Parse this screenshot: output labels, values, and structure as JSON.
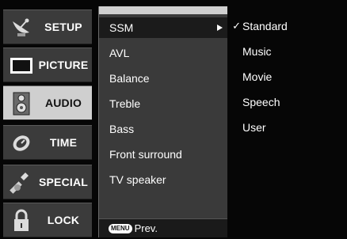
{
  "menu": {
    "categories": [
      {
        "label": "SETUP",
        "icon": "satellite-dish-icon",
        "active": false
      },
      {
        "label": "PICTURE",
        "icon": "tv-screen-icon",
        "active": false
      },
      {
        "label": "AUDIO",
        "icon": "speaker-icon",
        "active": true
      },
      {
        "label": "TIME",
        "icon": "clock-icon",
        "active": false
      },
      {
        "label": "SPECIAL",
        "icon": "wrench-icon",
        "active": false
      },
      {
        "label": "LOCK",
        "icon": "padlock-icon",
        "active": false
      }
    ]
  },
  "submenu": {
    "items": [
      {
        "label": "SSM"
      },
      {
        "label": "AVL"
      },
      {
        "label": "Balance"
      },
      {
        "label": "Treble"
      },
      {
        "label": "Bass"
      },
      {
        "label": "Front surround"
      },
      {
        "label": "TV speaker"
      }
    ],
    "footer": {
      "button_label": "MENU",
      "text": "Prev."
    }
  },
  "options": {
    "check_mark": "✓",
    "items": [
      {
        "label": "Standard",
        "selected": true
      },
      {
        "label": "Music",
        "selected": false
      },
      {
        "label": "Movie",
        "selected": false
      },
      {
        "label": "Speech",
        "selected": false
      },
      {
        "label": "User",
        "selected": false
      }
    ]
  }
}
